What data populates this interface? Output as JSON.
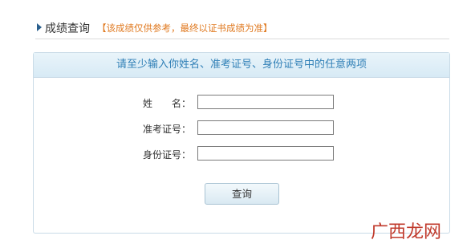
{
  "header": {
    "title": "成绩查询",
    "note": "【该成绩仅供参考，最终以证书成绩为准】"
  },
  "panel": {
    "heading": "请至少输入你姓名、准考证号、身份证号中的任意两项"
  },
  "form": {
    "name_label": "姓　　名：",
    "exam_id_label": "准考证号：",
    "id_card_label": "身份证号：",
    "name_value": "",
    "exam_id_value": "",
    "id_card_value": "",
    "submit_label": "查询"
  },
  "watermark": "广西龙网",
  "colors": {
    "accent": "#2f7fb6",
    "note": "#e07a21",
    "watermark": "#c0392b"
  }
}
